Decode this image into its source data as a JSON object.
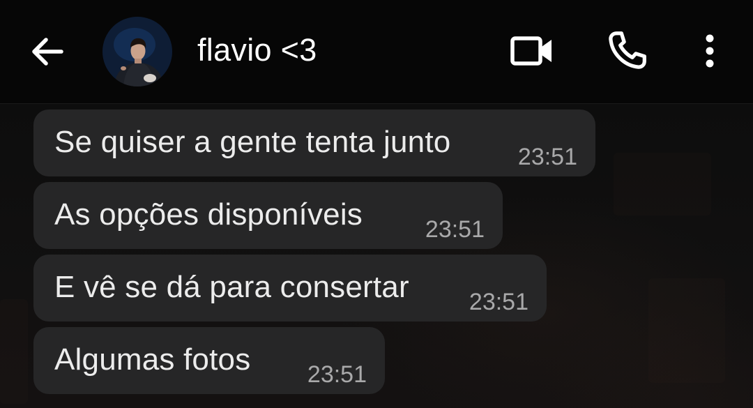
{
  "header": {
    "contact_name": "flavio <3",
    "icons": {
      "back": "arrow-left-icon",
      "video": "video-camera-icon",
      "call": "phone-icon",
      "menu": "more-vertical-icon"
    },
    "background_color": "#060606"
  },
  "messages": [
    {
      "text": "Se quiser a gente tenta junto",
      "time": "23:51"
    },
    {
      "text": "As opções disponíveis",
      "time": "23:51"
    },
    {
      "text": "E vê se dá para consertar",
      "time": "23:51"
    },
    {
      "text": "Algumas fotos",
      "time": "23:51"
    }
  ],
  "colors": {
    "bubble": "#262627",
    "text": "#ececec",
    "timestamp": "#a9a9aa",
    "chat_background": "#0d0d0d"
  }
}
